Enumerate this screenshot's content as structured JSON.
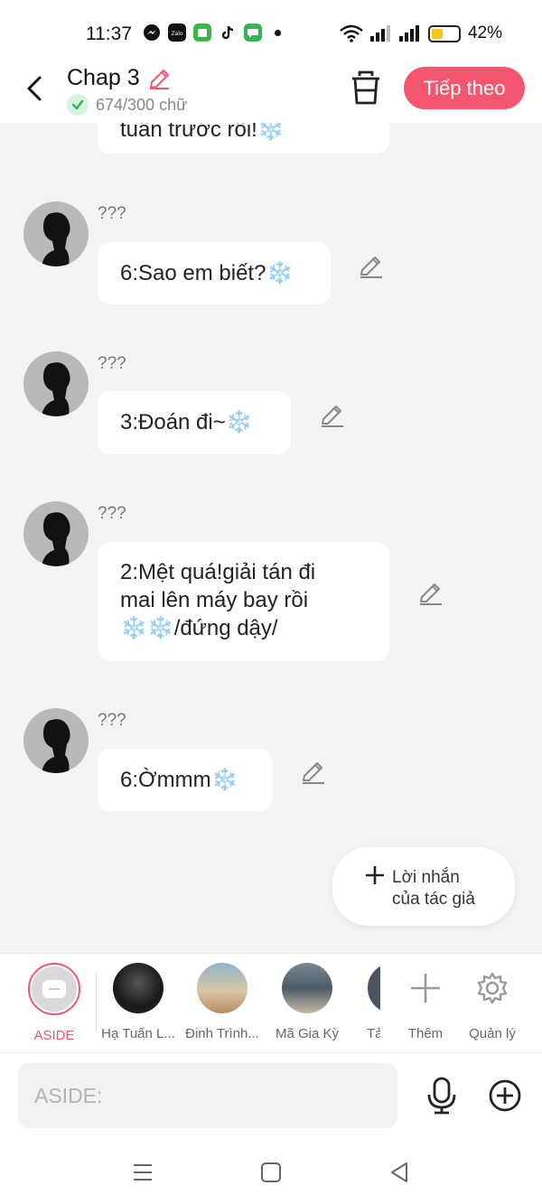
{
  "status_bar": {
    "time": "11:37",
    "battery_percent": "42%",
    "battery_level": 0.42,
    "app_icons": [
      "messenger-icon",
      "zalo-icon",
      "store-icon",
      "tiktok-icon",
      "messages-icon"
    ]
  },
  "header": {
    "title": "Chap 3",
    "word_count": "674/300 chữ",
    "next_label": "Tiếp theo"
  },
  "chat": {
    "partial_message": "tuần trước rồi!❄️",
    "messages": [
      {
        "sender": "???",
        "text": "6:Sao em biết?❄️"
      },
      {
        "sender": "???",
        "text": "3:Đoán đi~❄️"
      },
      {
        "sender": "???",
        "line1": "2:Mệt quá!giải tán đi",
        "line2": "mai lên máy bay rồi",
        "line3": "❄️❄️/đứng dậy/"
      },
      {
        "sender": "???",
        "text": "6:Ờmmm❄️"
      }
    ]
  },
  "author_note_label_line1": "Lời nhắn",
  "author_note_label_line2": "của tác giả",
  "characters": {
    "aside": "ASIDE",
    "items": [
      {
        "name": "Hạ Tuấn L..."
      },
      {
        "name": "Đinh Trình..."
      },
      {
        "name": "Mã Gia Kỳ"
      },
      {
        "name": "Tả"
      }
    ],
    "add_label": "Thêm",
    "manage_label": "Quản lý"
  },
  "input": {
    "placeholder": "ASIDE:",
    "value": ""
  },
  "colors": {
    "accent": "#f4566f",
    "background": "#f4f4f4",
    "bubble": "#ffffff"
  }
}
